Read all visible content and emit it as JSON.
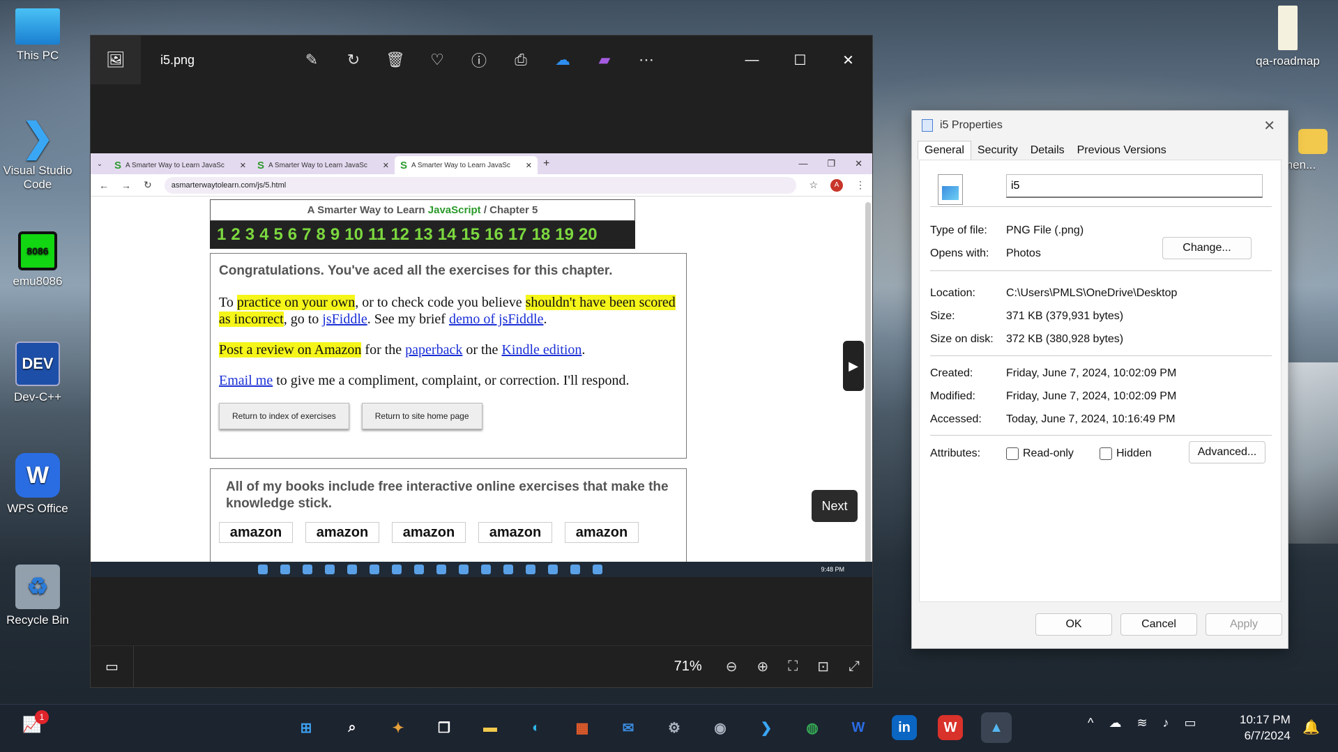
{
  "desktop": {
    "icons": [
      {
        "label": "This PC",
        "icon": "monitor-icon"
      },
      {
        "label": "Visual Studio Code",
        "icon": "vscode-icon"
      },
      {
        "label": "emu8086",
        "icon": "chip-icon",
        "chip_text": "8086"
      },
      {
        "label": "Dev-C++",
        "icon": "devcpp-icon",
        "chip_text": "DEV"
      },
      {
        "label": "WPS Office",
        "icon": "wps-icon"
      },
      {
        "label": "Recycle Bin",
        "icon": "recycle-bin-icon"
      }
    ],
    "right_icons": [
      {
        "label": "qa-roadmap",
        "icon": "document-icon"
      },
      {
        "label": "men...",
        "icon": "folder-icon"
      }
    ]
  },
  "photos": {
    "title": "i5.png",
    "tools": [
      "edit-icon",
      "rotate-icon",
      "delete-icon",
      "favorite-icon",
      "info-icon",
      "print-icon",
      "onedrive-icon",
      "clipchamp-icon",
      "more-icon"
    ],
    "zoom": "71%",
    "next_label": "Next"
  },
  "browser": {
    "tabs": [
      "A Smarter Way to Learn JavaSc",
      "A Smarter Way to Learn JavaSc",
      "A Smarter Way to Learn JavaSc"
    ],
    "url": "asmarterwaytolearn.com/js/5.html",
    "avatar": "A"
  },
  "page": {
    "header_prefix": "A Smarter Way to Learn ",
    "header_js": "JavaScript",
    "header_suffix": "  /  Chapter 5",
    "chapters": [
      "1",
      "2",
      "3",
      "4",
      "5",
      "6",
      "7",
      "8",
      "9",
      "10",
      "11",
      "12",
      "13",
      "14",
      "15",
      "16",
      "17",
      "18",
      "19",
      "20"
    ],
    "congrats": "Congratulations. You've aced all the exercises for this chapter.",
    "p1_a": "To ",
    "p1_hl1": "practice on your own",
    "p1_b": ", or to check code you believe ",
    "p1_hl2": "shouldn't have been scored as incorrect",
    "p1_c": ", go to ",
    "p1_link1": "jsFiddle",
    "p1_d": ". See my brief ",
    "p1_link2": "demo of jsFiddle",
    "p1_e": ".",
    "p2_hl": "Post a review on Amazon",
    "p2_a": " for the ",
    "p2_link1": "paperback",
    "p2_b": " or the ",
    "p2_link2": "Kindle edition",
    "p2_c": ".",
    "p3_link": "Email me",
    "p3_a": " to give me a compliment, complaint, or correction. I'll respond.",
    "btn_index": "Return to index of exercises",
    "btn_home": "Return to site home page",
    "books": "All of my books include free interactive online exercises that make the knowledge stick.",
    "amazon": [
      "amazon",
      "amazon",
      "amazon",
      "amazon",
      "amazon"
    ],
    "mini_time": "9:48 PM"
  },
  "props": {
    "title": "i5 Properties",
    "tabs": [
      "General",
      "Security",
      "Details",
      "Previous Versions"
    ],
    "name": "i5",
    "type_label": "Type of file:",
    "type_value": "PNG File (.png)",
    "opens_label": "Opens with:",
    "opens_value": "Photos",
    "change_btn": "Change...",
    "location_label": "Location:",
    "location_value": "C:\\Users\\PMLS\\OneDrive\\Desktop",
    "size_label": "Size:",
    "size_value": "371 KB (379,931 bytes)",
    "disk_label": "Size on disk:",
    "disk_value": "372 KB (380,928 bytes)",
    "created_label": "Created:",
    "created_value": "Friday, June 7, 2024, 10:02:09 PM",
    "modified_label": "Modified:",
    "modified_value": "Friday, June 7, 2024, 10:02:09 PM",
    "accessed_label": "Accessed:",
    "accessed_value": "Today, June 7, 2024, 10:16:49 PM",
    "attr_label": "Attributes:",
    "readonly": "Read-only",
    "hidden": "Hidden",
    "advanced_btn": "Advanced...",
    "ok": "OK",
    "cancel": "Cancel",
    "apply": "Apply"
  },
  "taskbar": {
    "apps": [
      "start-icon",
      "search-icon",
      "copilot-icon",
      "task-view-icon",
      "file-explorer-icon",
      "edge-icon",
      "store-icon",
      "mail-icon",
      "settings-icon",
      "camera-icon",
      "vscode-icon",
      "chrome-icon",
      "wps-icon",
      "linkedin-icon",
      "wps-writer-icon",
      "photos-icon"
    ],
    "badge_left": "1",
    "time": "10:17 PM",
    "date": "6/7/2024"
  }
}
